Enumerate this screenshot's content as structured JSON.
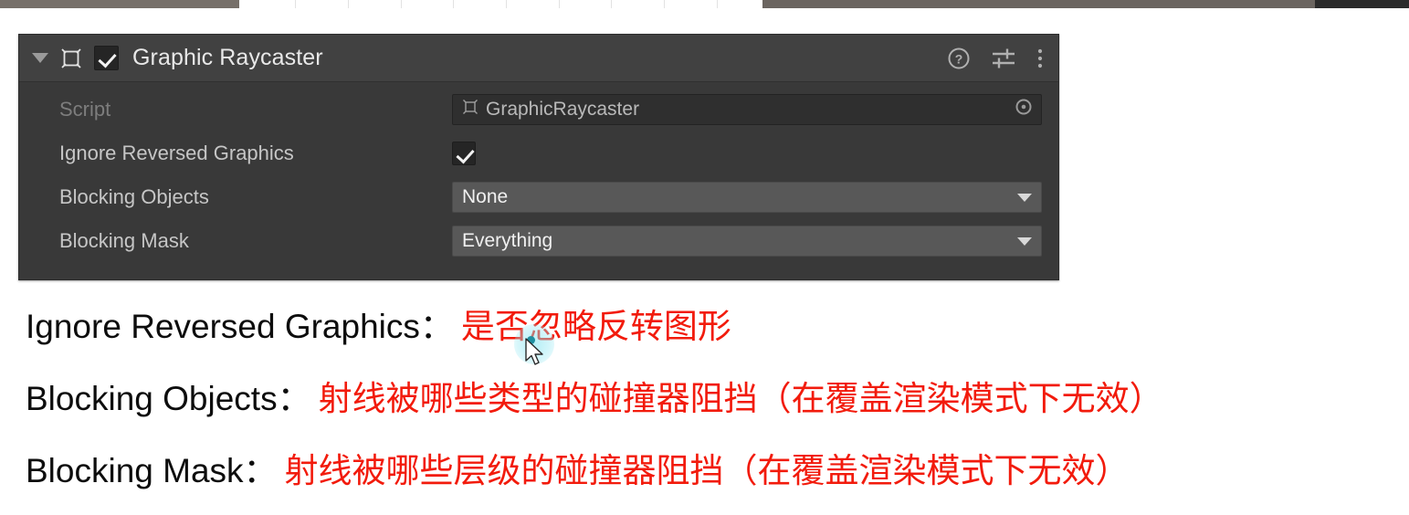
{
  "top_bar": {
    "segments": [
      "toolbar-left-dark",
      "toolbar-white-ruler",
      "toolbar-right-dark",
      "toolbar-far-right"
    ]
  },
  "inspector": {
    "component": {
      "title": "Graphic Raycaster",
      "enabled_checkbox": true,
      "foldout_expanded": true,
      "icon_name": "graphic-raycaster-icon",
      "header_icons": [
        {
          "name": "help-icon",
          "label": "?"
        },
        {
          "name": "preset-icon",
          "label": "Preset"
        },
        {
          "name": "more-menu-icon",
          "label": "More"
        }
      ]
    },
    "properties": [
      {
        "label": "Script",
        "disabled": true,
        "type": "object",
        "value": "GraphicRaycaster",
        "value_icon": "script-icon",
        "picker_icon": "object-picker-icon"
      },
      {
        "label": "Ignore Reversed Graphics",
        "disabled": false,
        "type": "checkbox",
        "value": true
      },
      {
        "label": "Blocking Objects",
        "disabled": false,
        "type": "dropdown",
        "value": "None"
      },
      {
        "label": "Blocking Mask",
        "disabled": false,
        "type": "dropdown",
        "value": "Everything"
      }
    ]
  },
  "annotations": [
    {
      "english": "Ignore Reversed Graphics：",
      "chinese": "是否忽略反转图形"
    },
    {
      "english": "Blocking Objects：",
      "chinese": "射线被哪些类型的碰撞器阻挡（在覆盖渲染模式下无效）"
    },
    {
      "english": "Blocking Mask：",
      "chinese": "射线被哪些层级的碰撞器阻挡（在覆盖渲染模式下无效）"
    }
  ],
  "cursor": {
    "name": "mouse-pointer",
    "click_highlight_color": "#78e1ee",
    "dot_color": "#1f8fa0"
  },
  "colors": {
    "panel_bg": "#393939",
    "header_bg": "#414141",
    "object_field_bg": "#2f2f2f",
    "dropdown_bg": "#585858",
    "label": "#c6c6c6",
    "label_disabled": "#7d7d7d",
    "annotation_red": "#f21b0c",
    "annotation_black": "#0d0d0d"
  }
}
